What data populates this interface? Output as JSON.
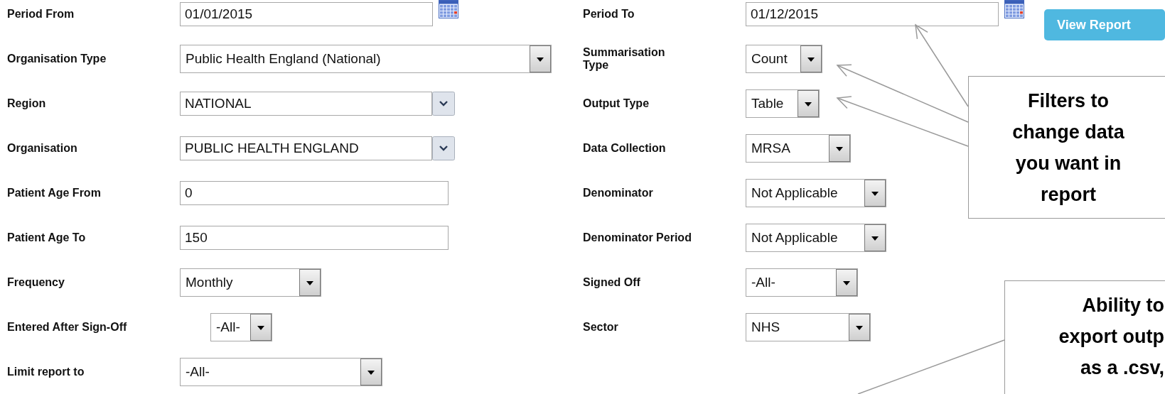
{
  "left_fields": [
    {
      "label": "Period From",
      "kind": "date",
      "value": "01/01/2015"
    },
    {
      "label": "Organisation Type",
      "kind": "select",
      "value": "Public Health England (National)"
    },
    {
      "label": "Region",
      "kind": "combo",
      "value": "NATIONAL"
    },
    {
      "label": "Organisation",
      "kind": "combo",
      "value": "PUBLIC HEALTH ENGLAND"
    },
    {
      "label": "Patient Age From",
      "kind": "text",
      "value": "0"
    },
    {
      "label": "Patient Age To",
      "kind": "text",
      "value": "150"
    },
    {
      "label": "Frequency",
      "kind": "select",
      "value": "Monthly"
    },
    {
      "label": "Entered After Sign-Off",
      "kind": "select",
      "value": "-All-"
    },
    {
      "label": "Limit report to",
      "kind": "select",
      "value": "-All-"
    }
  ],
  "right_fields": [
    {
      "label": "Period To",
      "kind": "date",
      "value": "01/12/2015"
    },
    {
      "label": "Summarisation Type",
      "kind": "select",
      "value": "Count"
    },
    {
      "label": "Output Type",
      "kind": "select",
      "value": "Table"
    },
    {
      "label": "Data Collection",
      "kind": "select",
      "value": "MRSA"
    },
    {
      "label": "Denominator",
      "kind": "select",
      "value": "Not Applicable"
    },
    {
      "label": "Denominator Period",
      "kind": "select",
      "value": "Not Applicable"
    },
    {
      "label": "Signed Off",
      "kind": "select",
      "value": "-All-"
    },
    {
      "label": "Sector",
      "kind": "select",
      "value": "NHS"
    }
  ],
  "view_report_button": "View Report",
  "callouts": [
    {
      "lines": [
        "Filters to",
        "change data",
        "you want in",
        "report"
      ]
    },
    {
      "lines": [
        "Ability to",
        "export outp",
        "as a .csv,"
      ]
    }
  ]
}
